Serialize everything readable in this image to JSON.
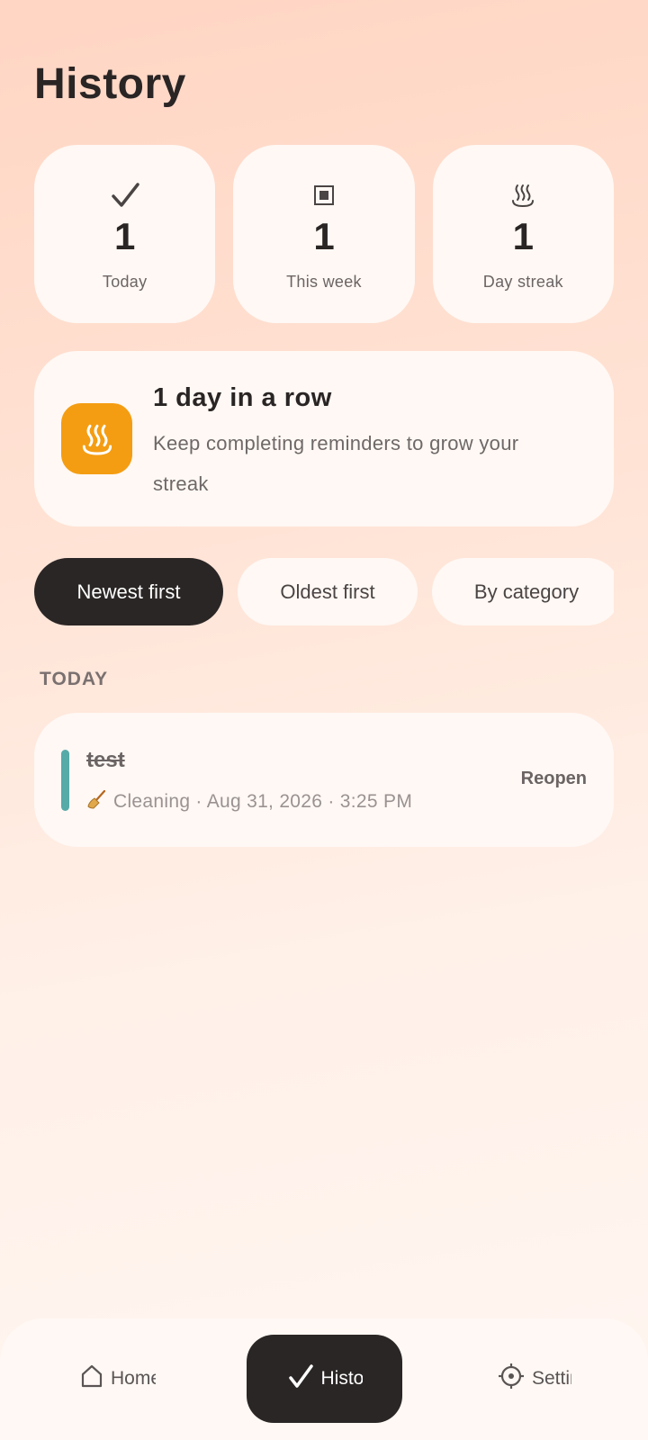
{
  "header": {
    "title": "History"
  },
  "stats": [
    {
      "icon": "check-icon",
      "value": "1",
      "label": "Today"
    },
    {
      "icon": "square-icon",
      "value": "1",
      "label": "This week"
    },
    {
      "icon": "streak-flame-icon",
      "value": "1",
      "label": "Day streak"
    }
  ],
  "streak": {
    "icon": "streak-flame-icon",
    "title": "1 day in a row",
    "subtitle": "Keep completing reminders to grow your streak",
    "accent": "#f49d12"
  },
  "sort_chips": [
    {
      "label": "Newest first",
      "active": true
    },
    {
      "label": "Oldest first",
      "active": false
    },
    {
      "label": "By category",
      "active": false
    }
  ],
  "sections": [
    {
      "label": "TODAY",
      "items": [
        {
          "title": "test",
          "category_icon": "broom-icon",
          "meta": "Cleaning · Aug 31, 2026 · 3:25 PM",
          "action": "Reopen",
          "color": "#56aaa8"
        }
      ]
    }
  ],
  "nav": {
    "home": {
      "label": "Home",
      "icon": "home-icon"
    },
    "history": {
      "label": "History",
      "icon": "check-icon",
      "active": true
    },
    "settings": {
      "label": "Settings",
      "icon": "gear-icon"
    }
  }
}
